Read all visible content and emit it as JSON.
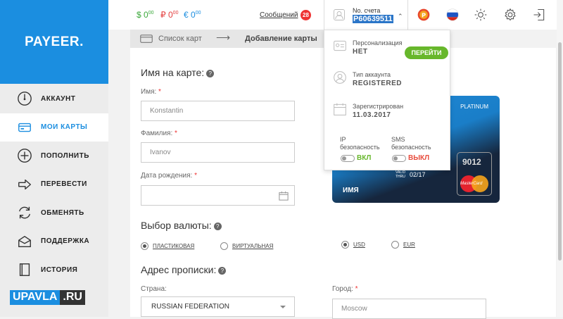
{
  "app": {
    "logo": "PAYEER",
    "logo_dot": "."
  },
  "balances": [
    {
      "symbol": "$",
      "amount": "0",
      "cents": "00"
    },
    {
      "symbol": "₽",
      "amount": "0",
      "cents": "00"
    },
    {
      "symbol": "€",
      "amount": "0",
      "cents": "00"
    }
  ],
  "colors": {
    "brand": "#1b8ee0",
    "balance_green": "#3aa83a",
    "balance_red": "#e33c3c",
    "balance_blue": "#1b8ee0",
    "on_green": "#67b72b",
    "off_red": "#e84c3d"
  },
  "messages": {
    "label": "Сообщений",
    "count": "28"
  },
  "account": {
    "label": "No. счета",
    "number": "P60639511"
  },
  "sidebar": {
    "items": [
      {
        "label": "АККАУНТ",
        "icon": "gauge-icon"
      },
      {
        "label": "МОИ КАРТЫ",
        "icon": "card-icon"
      },
      {
        "label": "ПОПОЛНИТЬ",
        "icon": "plus-circle-icon"
      },
      {
        "label": "ПЕРЕВЕСТИ",
        "icon": "arrow-right-icon"
      },
      {
        "label": "ОБМЕНЯТЬ",
        "icon": "exchange-icon"
      },
      {
        "label": "ПОДДЕРЖКА",
        "icon": "envelope-icon"
      },
      {
        "label": "ИСТОРИЯ",
        "icon": "book-icon"
      }
    ]
  },
  "watermark": {
    "a": "UPAVLA",
    "b": ".RU"
  },
  "breadcrumb": {
    "list": "Список карт",
    "current": "Добавление карты"
  },
  "form": {
    "name_section": "Имя на карте:",
    "first_name_label": "Имя:",
    "first_name_value": "Konstantin",
    "last_name_label": "Фамилия:",
    "last_name_value": "Ivanov",
    "dob_label": "Дата рождения:",
    "currency_section": "Выбор валюты:",
    "radio_plastic": "ПЛАСТИКОВАЯ",
    "radio_virtual": "ВИРТУАЛЬНАЯ",
    "radio_usd": "USD",
    "radio_eur": "EUR",
    "address_section": "Адрес прописки:",
    "country_label": "Страна:",
    "country_value": "RUSSIAN FEDERATION",
    "city_label": "Город:",
    "city_value": "Moscow",
    "required_mark": "*",
    "help_mark": "?"
  },
  "card": {
    "tier": "PLATINUM",
    "valid_thru": "VALID\nTHRU",
    "expiry": "02/17",
    "holder": "ИМЯ",
    "mc_number": "9012",
    "mc_brand": "MasterCard"
  },
  "dropdown": {
    "personalization_label": "Персонализация",
    "personalization_value": "НЕТ",
    "go_button": "ПЕРЕЙТИ",
    "account_type_label": "Тип аккаунта",
    "account_type_value": "REGISTERED",
    "registered_label": "Зарегистрирован",
    "registered_value": "11.03.2017",
    "ip_security_label": "IP\nбезопасность",
    "ip_security_state": "ВКЛ",
    "sms_security_label": "SMS\nбезопасность",
    "sms_security_state": "ВЫКЛ"
  }
}
